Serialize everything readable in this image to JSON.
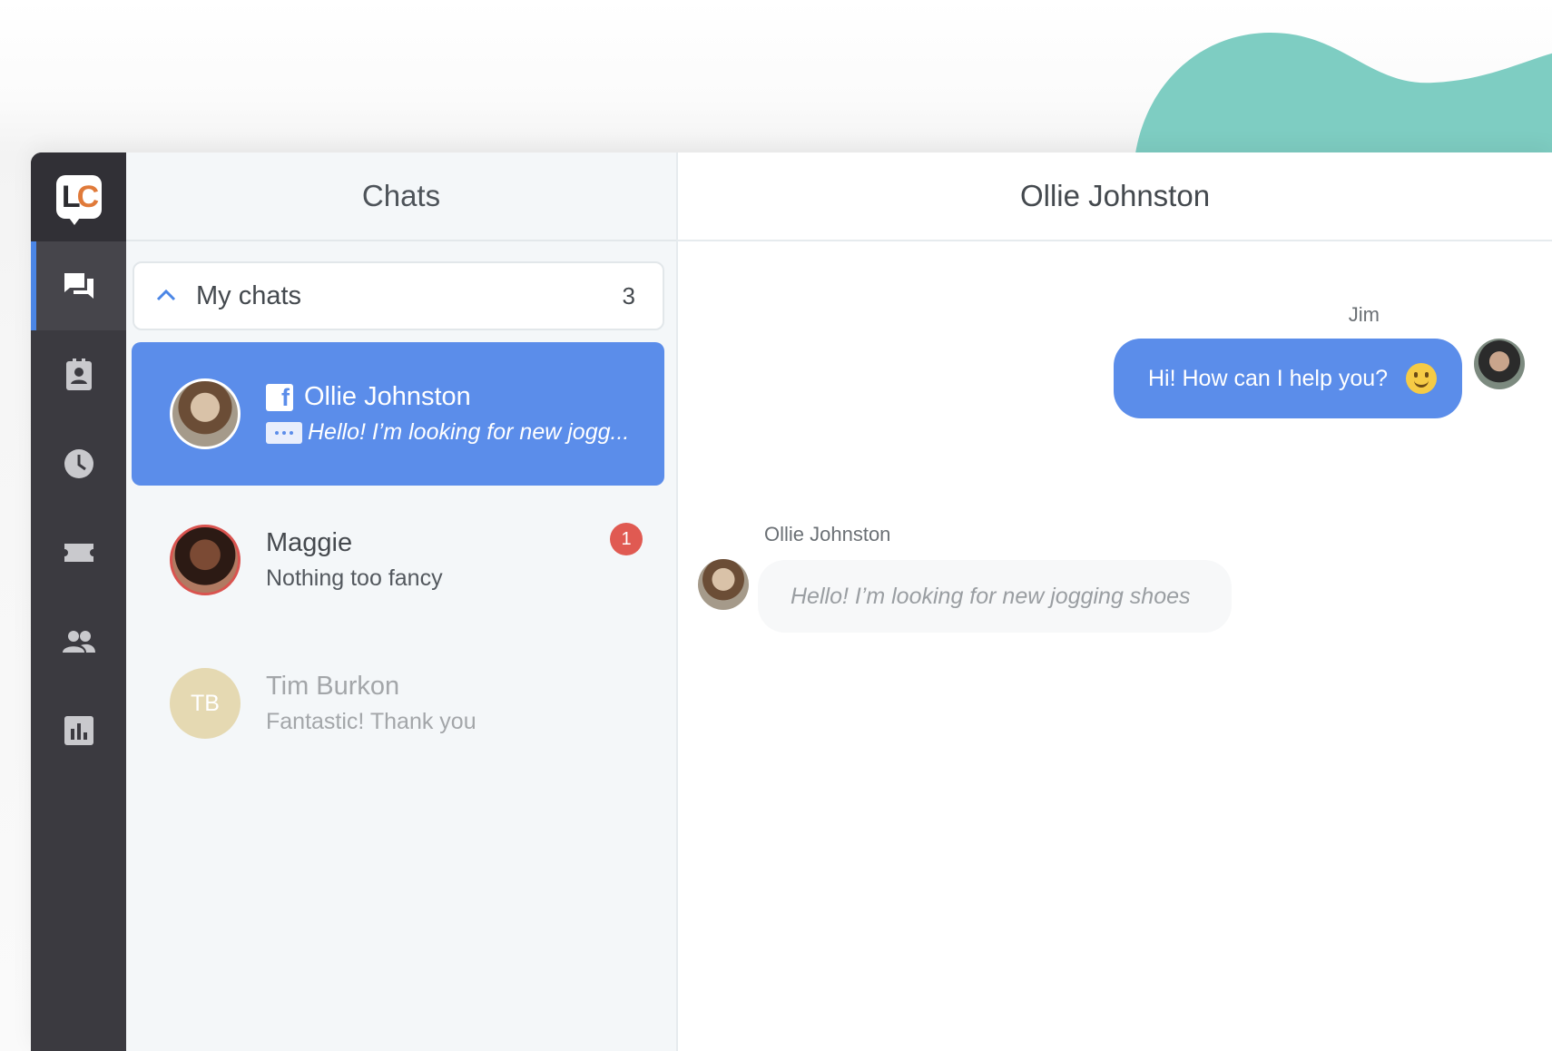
{
  "brand": {
    "logo_l": "L",
    "logo_c": "C",
    "accent": "#5b8dea",
    "rail_bg": "#3b3a40",
    "blob_color": "#7ecdc2"
  },
  "rail": {
    "items": [
      {
        "icon": "chats-icon",
        "active": true
      },
      {
        "icon": "contacts-icon",
        "active": false
      },
      {
        "icon": "history-icon",
        "active": false
      },
      {
        "icon": "tickets-icon",
        "active": false
      },
      {
        "icon": "team-icon",
        "active": false
      },
      {
        "icon": "reports-icon",
        "active": false
      }
    ]
  },
  "chat_list": {
    "header": "Chats",
    "section": {
      "title": "My chats",
      "count": "3"
    },
    "items": [
      {
        "name": "Ollie Johnston",
        "preview": "Hello! I’m looking for new jogg...",
        "selected": true,
        "channel": "facebook-icon",
        "typing": true
      },
      {
        "name": "Maggie",
        "preview": "Nothing too fancy",
        "unread": "1"
      },
      {
        "name": "Tim Burkon",
        "initials": "TB",
        "preview": "Fantastic! Thank you",
        "faded": true
      }
    ]
  },
  "conversation": {
    "title": "Ollie Johnston",
    "messages": [
      {
        "author": "Jim",
        "text": "Hi! How can I help you?",
        "from_agent": true,
        "emoji": "smile-emoji"
      },
      {
        "author": "Ollie Johnston",
        "text": "Hello! I’m looking for new jogging shoes",
        "from_agent": false,
        "typing": true
      }
    ]
  }
}
